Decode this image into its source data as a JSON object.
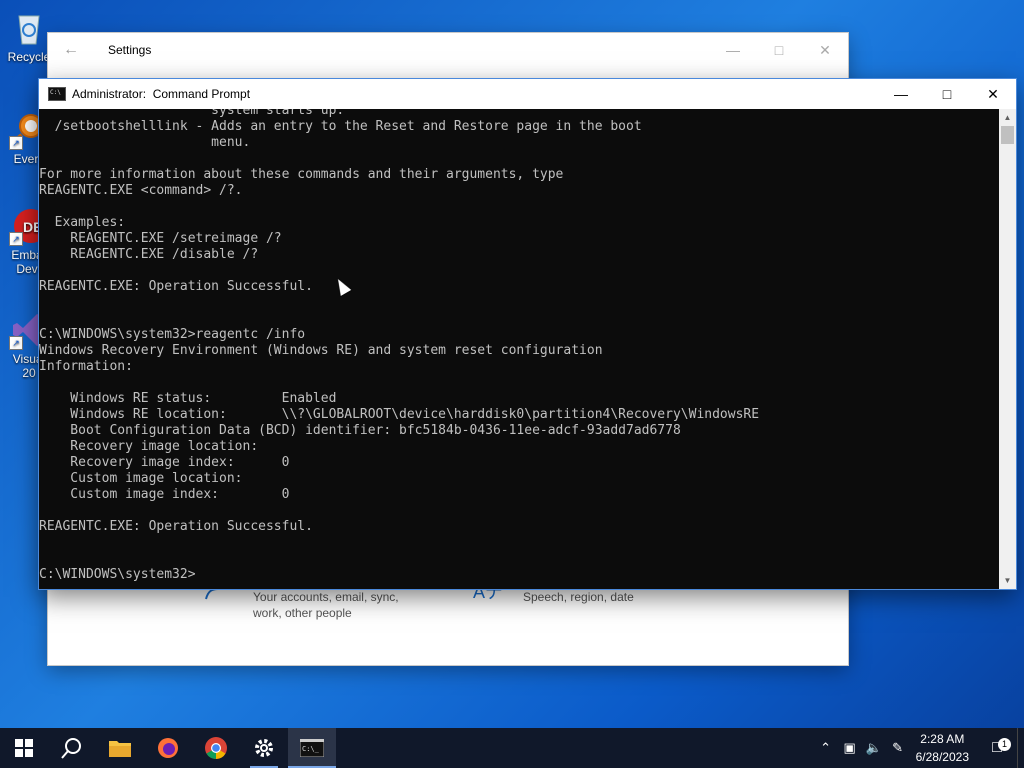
{
  "desktop": {
    "icons": [
      {
        "label": "Recycle",
        "icon": "recycle-bin-icon"
      },
      {
        "label": "Every",
        "icon": "everything-search-icon"
      },
      {
        "label": "Embar",
        "label2": "Dev-",
        "icon": "embarcadero-dev-icon"
      },
      {
        "label": "Visual",
        "label2": "20",
        "icon": "visual-studio-icon"
      }
    ]
  },
  "settings": {
    "title": "Settings",
    "accounts_desc_line1": "Your accounts, email, sync,",
    "accounts_desc_line2": "work, other people",
    "time_desc": "Speech, region, date"
  },
  "cmd": {
    "title": "Administrator:  Command Prompt",
    "lines": [
      "                      system starts up.",
      "  /setbootshelllink - Adds an entry to the Reset and Restore page in the boot",
      "                      menu.",
      "",
      "For more information about these commands and their arguments, type",
      "REAGENTC.EXE <command> /?.",
      "",
      "  Examples:",
      "    REAGENTC.EXE /setreimage /?",
      "    REAGENTC.EXE /disable /?",
      "",
      "REAGENTC.EXE: Operation Successful.",
      "",
      "",
      "C:\\WINDOWS\\system32>reagentc /info",
      "Windows Recovery Environment (Windows RE) and system reset configuration",
      "Information:",
      "",
      "    Windows RE status:         Enabled",
      "    Windows RE location:       \\\\?\\GLOBALROOT\\device\\harddisk0\\partition4\\Recovery\\WindowsRE",
      "    Boot Configuration Data (BCD) identifier: bfc5184b-0436-11ee-adcf-93add7ad6778",
      "    Recovery image location:",
      "    Recovery image index:      0",
      "    Custom image location:",
      "    Custom image index:        0",
      "",
      "REAGENTC.EXE: Operation Successful.",
      "",
      "",
      "C:\\WINDOWS\\system32>"
    ]
  },
  "taskbar": {
    "apps": [
      "start-icon",
      "search-icon",
      "file-explorer-icon",
      "firefox-icon",
      "chrome-icon",
      "settings-gear-icon",
      "command-prompt-icon"
    ],
    "time": "2:28 AM",
    "date": "6/28/2023",
    "notification_count": "1"
  },
  "colors": {
    "console_bg": "#0c0c0c",
    "console_fg": "#c0c0c0",
    "taskbar_bg": "#10182a",
    "accent": "#1a6fd0"
  }
}
